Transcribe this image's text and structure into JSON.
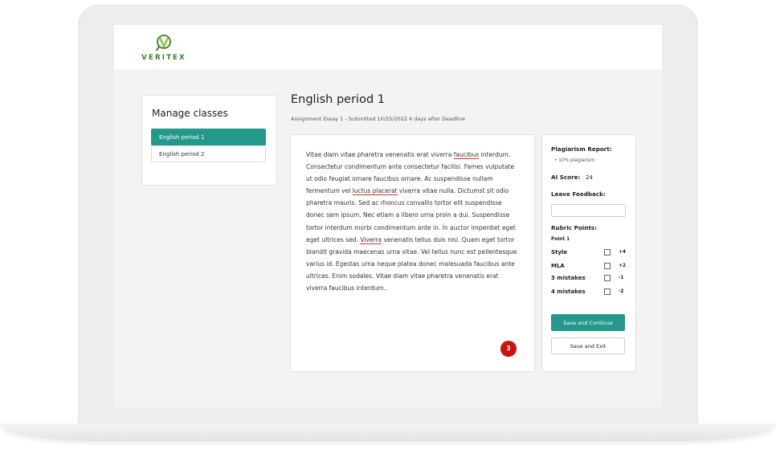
{
  "brand": {
    "logo_text": "VERITEX",
    "accent_color": "#23998b",
    "logo_color": "#3d7d2a"
  },
  "sidebar": {
    "title": "Manage classes",
    "items": [
      {
        "label": "English period 1",
        "active": true
      },
      {
        "label": "English period 2",
        "active": false
      }
    ]
  },
  "main": {
    "title": "English period 1",
    "subtitle": "Assignment Essay 1 - Submitted 10/25/2022 4 days after Deadline",
    "essay": {
      "p1": "Vitae diam vitae pharetra venenatis erat viverra ",
      "hl1": "faucibus",
      "p2": " interdum. Consectetur condimentum ante consectetur facilisi. Fames vulputate ut odio feugiat ornare faucibus ornare. Ac suspendisse nullam fermentum vel ",
      "hl2": "luctus placerat",
      "p3": " viverra vitae nulla. Dictumst sit odio pharetra mauris. Sed ac rhoncus convallis tortor elit suspendisse donec sem ipsum. Nec etiam a libero urna proin a dui. Suspendisse tortor interdum morbi condimentum ante in. In auctor imperdiet eget eget ultrices sed. ",
      "hl3": "Viverra",
      "p4": " venenatis tellus duis nisi. Quam eget tortor blandit gravida maecenas urna vitae. Vel tellus nunc est pellentesque varius id. Egestas urna neque platea donec malesuada faucibus ante ultrices. Enim sodales. Vitae diam vitae pharetra venenatis erat viverra faucibus interdum..",
      "highlight_count": "3"
    }
  },
  "panel": {
    "plagiarism_label": "Plagiarism Report:",
    "plagiarism_value": "•  10% plagiarism",
    "ai_score_label": "AI Score:",
    "ai_score_value": "24",
    "feedback_label": "Leave Feedback:",
    "feedback_value": "",
    "rubric_label": "Rubric Points:",
    "rubric_section": "Point 1",
    "rubric_items": [
      {
        "label": "Style",
        "points": "+4",
        "checked": false
      },
      {
        "label": "MLA",
        "points": "+2",
        "checked": false
      },
      {
        "label": "3 mistakes",
        "points": "-1",
        "checked": false
      },
      {
        "label": "4 mistakes",
        "points": "-2",
        "checked": false
      }
    ],
    "save_continue": "Save and Continue",
    "save_exit": "Save and Exit"
  }
}
